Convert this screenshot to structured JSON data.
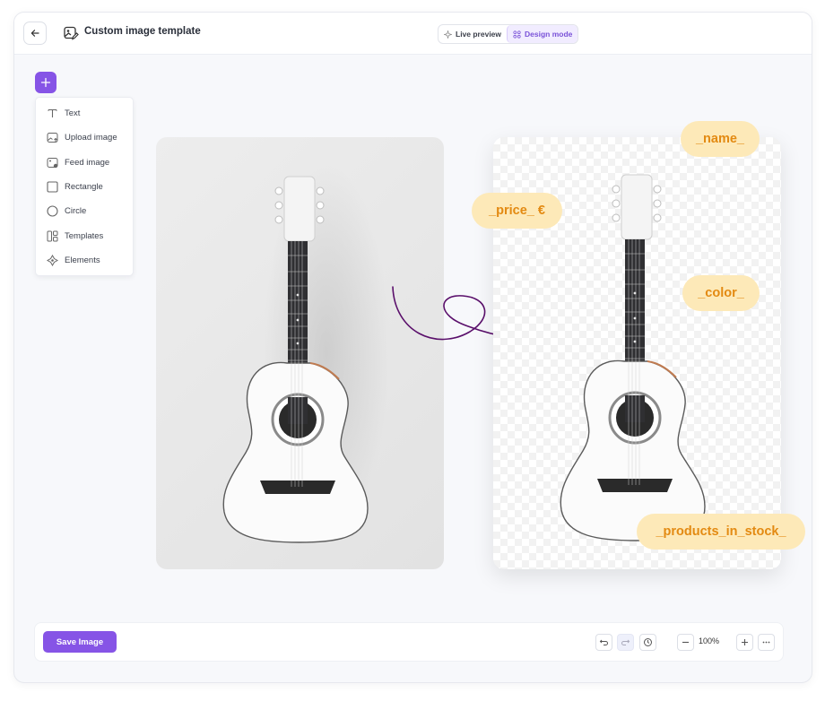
{
  "header": {
    "back_icon": "arrow-left-icon",
    "title_icon": "image-edit-icon",
    "title": "Custom image template",
    "modes": [
      {
        "label": "Live preview",
        "icon": "sparkle-icon",
        "active": false
      },
      {
        "label": "Design mode",
        "icon": "grid-icon",
        "active": true
      }
    ]
  },
  "add_menu": {
    "icon": "plus-icon",
    "items": [
      {
        "label": "Text",
        "icon": "text-icon"
      },
      {
        "label": "Upload image",
        "icon": "upload-image-icon"
      },
      {
        "label": "Feed image",
        "icon": "feed-image-icon"
      },
      {
        "label": "Rectangle",
        "icon": "rectangle-icon"
      },
      {
        "label": "Circle",
        "icon": "circle-icon"
      },
      {
        "label": "Templates",
        "icon": "templates-icon"
      },
      {
        "label": "Elements",
        "icon": "elements-icon"
      }
    ]
  },
  "canvas": {
    "tags": {
      "name": "_name_",
      "price": "_price_ €",
      "color": "_color_",
      "stock": "_products_in_stock_"
    }
  },
  "footer": {
    "save_label": "Save Image",
    "zoom": "100%",
    "icons": [
      "undo-icon",
      "redo-icon",
      "history-icon",
      "zoom-out-icon",
      "zoom-in-icon",
      "more-icon"
    ]
  },
  "colors": {
    "accent": "#8654e6",
    "tag_bg": "#fde9b8",
    "tag_text": "#e38a12",
    "arrow": "#5a0f6b"
  }
}
